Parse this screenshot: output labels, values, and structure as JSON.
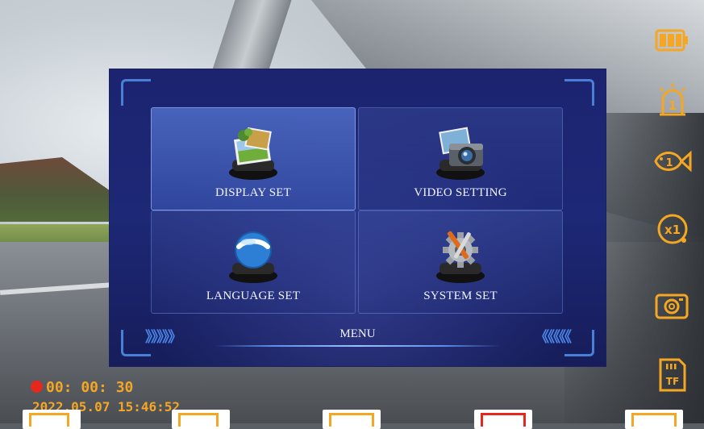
{
  "menu": {
    "title": "MENU",
    "left_arrows": "》》》》》",
    "right_arrows": "《《《《《",
    "items": [
      {
        "label": "DISPLAY SET",
        "icon": "display-photos-icon",
        "selected": true
      },
      {
        "label": "VIDEO SETTING",
        "icon": "camera-photos-icon",
        "selected": false
      },
      {
        "label": "LANGUAGE SET",
        "icon": "globe-icon",
        "selected": false
      },
      {
        "label": "SYSTEM SET",
        "icon": "gear-tools-icon",
        "selected": false
      }
    ]
  },
  "status_icons": [
    {
      "name": "battery-icon"
    },
    {
      "name": "alarm-level-icon",
      "text": "1"
    },
    {
      "name": "fish-sensitivity-icon",
      "text": "1"
    },
    {
      "name": "zoom-level-icon",
      "text": "x1"
    },
    {
      "name": "photo-camera-icon"
    },
    {
      "name": "tf-card-icon",
      "text": "TF"
    }
  ],
  "recording": {
    "time": "00: 00: 30",
    "datetime": "2022.05.07  15:46:52"
  },
  "colors": {
    "accent_orange": "#f5a623",
    "menu_blue": "#1c2470",
    "rec_red": "#e6271e",
    "arrow_blue": "#4a86e8"
  }
}
